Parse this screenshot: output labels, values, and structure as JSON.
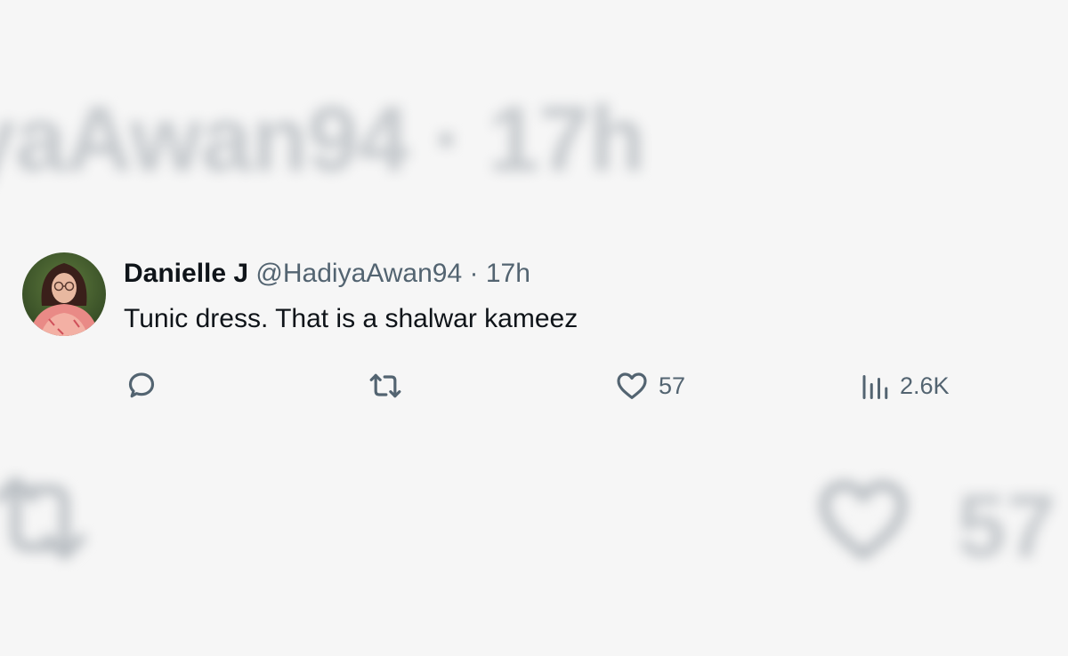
{
  "tweet": {
    "display_name": "Danielle J",
    "handle": "@HadiyaAwan94",
    "separator": "·",
    "timestamp": "17h",
    "text": "Tunic dress. That is a shalwar kameez",
    "avatar_icon": "profile-photo",
    "actions": {
      "reply": {
        "icon": "reply-icon",
        "count": ""
      },
      "retweet": {
        "icon": "retweet-icon",
        "count": ""
      },
      "like": {
        "icon": "heart-icon",
        "count": "57"
      },
      "views": {
        "icon": "views-chart-icon",
        "count": "2.6K"
      }
    }
  },
  "background_echo": {
    "handle_timestamp": "yaAwan94 · 17h",
    "like_count": "57"
  },
  "colors": {
    "background": "#f6f6f6",
    "text_primary": "#0f1419",
    "text_secondary": "#536471"
  }
}
